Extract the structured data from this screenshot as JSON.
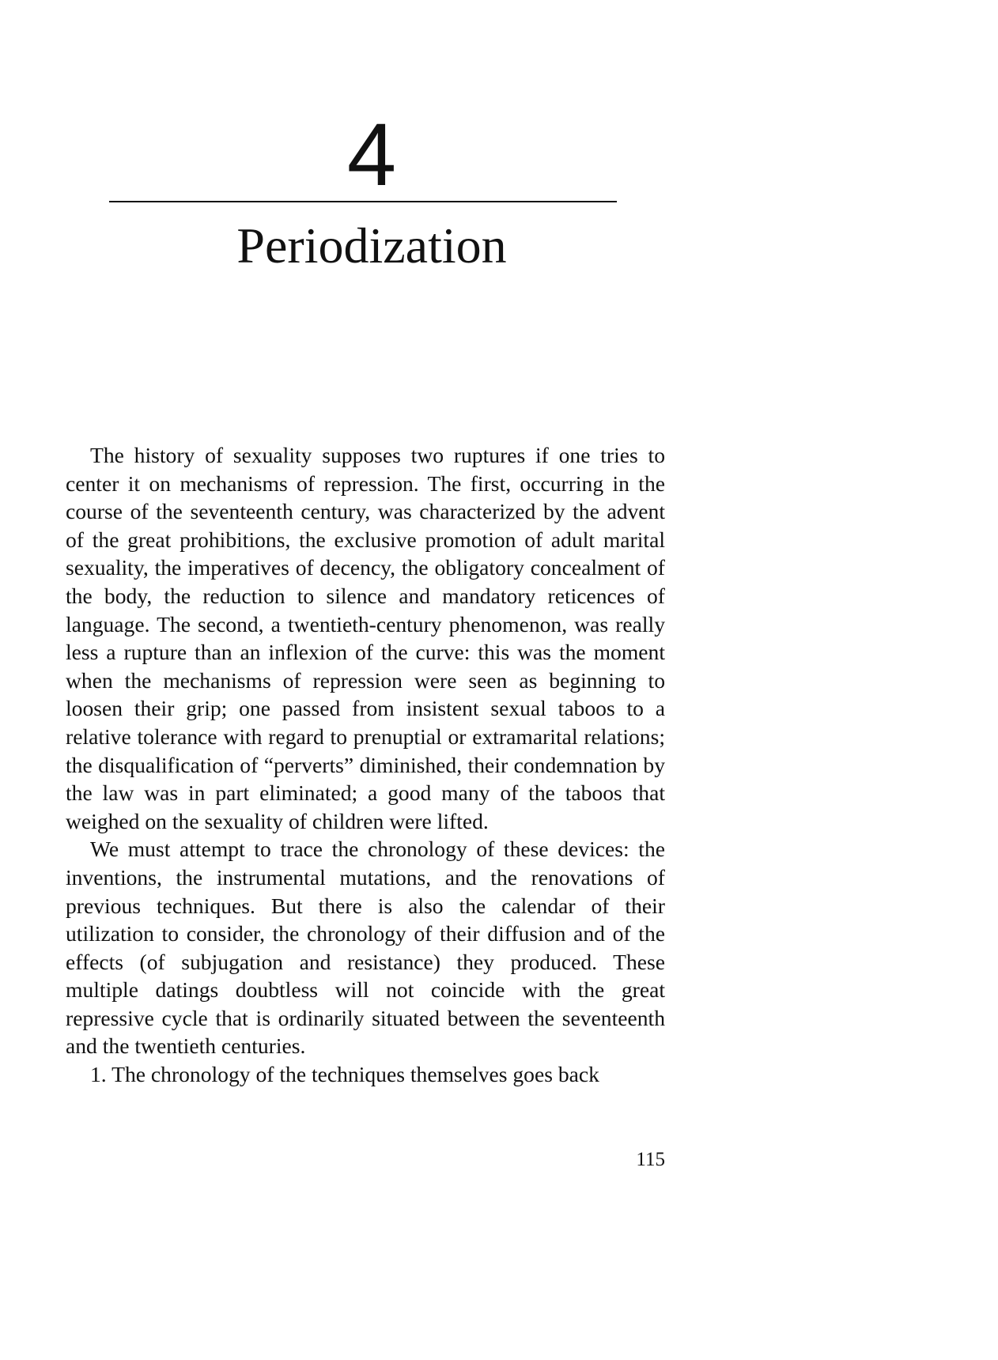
{
  "chapter": {
    "number": "4",
    "title": "Periodization"
  },
  "paragraphs": [
    "The history of sexuality supposes two ruptures if one tries to center it on mechanisms of repression. The first, occurring in the course of the seventeenth century, was characterized by the advent of the great prohibitions, the exclusive promo­tion of adult marital sexuality, the imperatives of decency, the obligatory concealment of the body, the reduction to silence and mandatory reticences of language. The second, a twentieth-century phenomenon, was really less a rupture than an inflexion of the curve: this was the moment when the mechanisms of repression were seen as beginning to loosen their grip; one passed from insistent sexual taboos to a rela­tive tolerance with regard to prenuptial or extramarital rela­tions; the disqualification of “perverts” diminished, their condemnation by the law was in part eliminated; a good many of the taboos that weighed on the sexuality of children were lifted.",
    "We must attempt to trace the chronology of these devices: the inventions, the instrumental mutations, and the renova­tions of previous techniques. But there is also the calendar of their utilization to consider, the chronology of their diffu­sion and of the effects (of subjugation and resistance) they produced. These multiple datings doubtless will not coincide with the great repressive cycle that is ordinarily situated between the seventeenth and the twentieth centuries.",
    "1. The chronology of the techniques themselves goes back"
  ],
  "page_number": "115"
}
